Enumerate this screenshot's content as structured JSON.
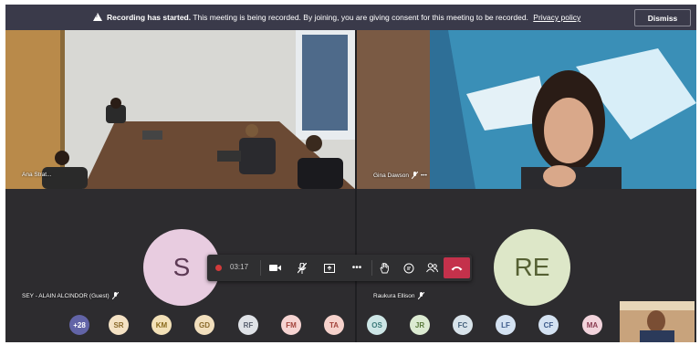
{
  "banner": {
    "title": "Recording has started.",
    "message": "This meeting is being recorded. By joining, you are giving consent for this meeting to be recorded.",
    "link": "Privacy policy",
    "dismiss_label": "Dismiss"
  },
  "tiles": {
    "room_name": "Ana Strat...",
    "gina_name": "Gina Dawson",
    "gina_more": "•••",
    "sey_name": "SEY - ALAIN ALCINDOR (Guest)",
    "sey_initial": "S",
    "raukura_name": "Raukura Ellison",
    "raukura_initials": "RE"
  },
  "controls": {
    "recording_time": "03:17",
    "more": "•••"
  },
  "participants": [
    {
      "label": "+28",
      "bg": "#6264a7",
      "fg": "#ffffff"
    },
    {
      "label": "SR",
      "bg": "#f4e2c4",
      "fg": "#8a6a2c"
    },
    {
      "label": "KM",
      "bg": "#f3e1b8",
      "fg": "#8a6a1c"
    },
    {
      "label": "GD",
      "bg": "#f2dfbd",
      "fg": "#8a6a2c"
    },
    {
      "label": "RF",
      "bg": "#dfe2e7",
      "fg": "#5a6170"
    },
    {
      "label": "FM",
      "bg": "#f6d4d2",
      "fg": "#a3443c"
    },
    {
      "label": "TA",
      "bg": "#f6d2cc",
      "fg": "#a3443c"
    },
    {
      "label": "OS",
      "bg": "#cde6e6",
      "fg": "#3c7a7a"
    },
    {
      "label": "JR",
      "bg": "#dcebd2",
      "fg": "#5a7a3c"
    },
    {
      "label": "FC",
      "bg": "#d8e3ea",
      "fg": "#44607a"
    },
    {
      "label": "LF",
      "bg": "#d4e2f2",
      "fg": "#3c5a8a"
    },
    {
      "label": "CF",
      "bg": "#d4e2f2",
      "fg": "#3c5a8a"
    },
    {
      "label": "MA",
      "bg": "#f2d4dc",
      "fg": "#8a3c52"
    }
  ]
}
